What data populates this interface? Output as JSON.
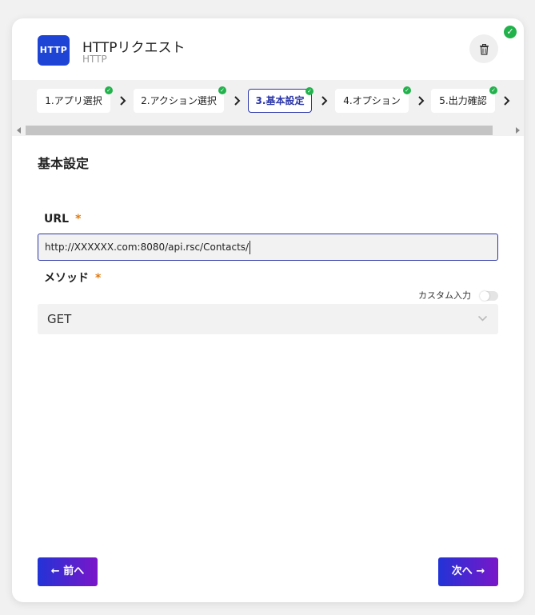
{
  "app": {
    "logo_text": "HTTP",
    "title": "HTTPリクエスト",
    "subtitle": "HTTP"
  },
  "colors": {
    "accent": "#2b36a8",
    "logo_bg": "#1e44d6",
    "success": "#22b24c",
    "required": "#e07b10",
    "button_gradient_start": "#2233d6",
    "button_gradient_end": "#7a16c9"
  },
  "steps": [
    {
      "label": "1.アプリ選択",
      "completed": true,
      "active": false
    },
    {
      "label": "2.アクション選択",
      "completed": true,
      "active": false
    },
    {
      "label": "3.基本設定",
      "completed": true,
      "active": true
    },
    {
      "label": "4.オプション",
      "completed": true,
      "active": false
    },
    {
      "label": "5.出力確認",
      "completed": true,
      "active": false
    }
  ],
  "section": {
    "title": "基本設定"
  },
  "url_field": {
    "label": "URL",
    "required_mark": "*",
    "value": "http://XXXXXX.com:8080/api.rsc/Contacts/"
  },
  "method_field": {
    "label": "メソッド",
    "required_mark": "*",
    "custom_input_label": "カスタム入力",
    "custom_input_on": false,
    "selected": "GET"
  },
  "nav": {
    "prev_label": "前へ",
    "next_label": "次へ",
    "prev_arrow": "←",
    "next_arrow": "→"
  },
  "icons": {
    "status": "check-circle-icon",
    "delete": "trash-icon",
    "step_separator": "chevron-right-icon",
    "select": "chevron-down-icon"
  }
}
